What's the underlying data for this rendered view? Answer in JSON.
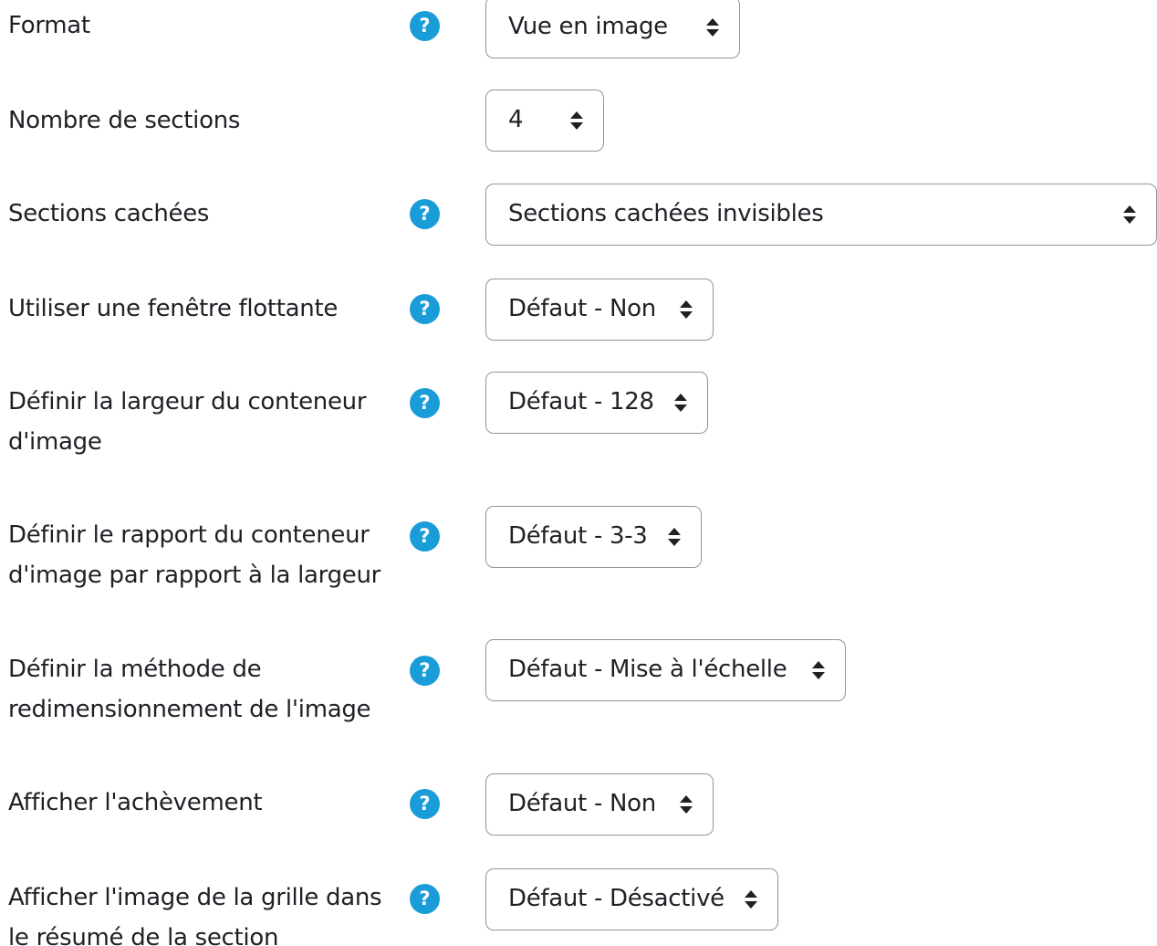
{
  "form": {
    "fields": [
      {
        "label": "Format",
        "value": "Vue en image",
        "help_icon": "question-circle-icon"
      },
      {
        "label": "Nombre de sections",
        "value": "4"
      },
      {
        "label": "Sections cachées",
        "value": "Sections cachées invisibles",
        "help_icon": "question-circle-icon"
      },
      {
        "label": "Utiliser une fenêtre flottante",
        "value": "Défaut - Non",
        "help_icon": "question-circle-icon"
      },
      {
        "label": "Définir la largeur du conteneur d'image",
        "value": "Défaut - 128",
        "help_icon": "question-circle-icon"
      },
      {
        "label": "Définir le rapport du conteneur d'image par rapport à la largeur",
        "value": "Défaut - 3-3",
        "help_icon": "question-circle-icon"
      },
      {
        "label": "Définir la méthode de redimensionnement de l'image",
        "value": "Défaut - Mise à l'échelle",
        "help_icon": "question-circle-icon"
      },
      {
        "label": "Afficher l'achèvement",
        "value": "Défaut - Non",
        "help_icon": "question-circle-icon"
      },
      {
        "label": "Afficher l'image de la grille dans le résumé de la section",
        "value": "Défaut - Désactivé",
        "help_icon": "question-circle-icon"
      }
    ],
    "help_glyph": "?"
  },
  "colors": {
    "help_icon": "#1a9cd8",
    "text": "#1d2125",
    "select_border": "#8f959e"
  }
}
